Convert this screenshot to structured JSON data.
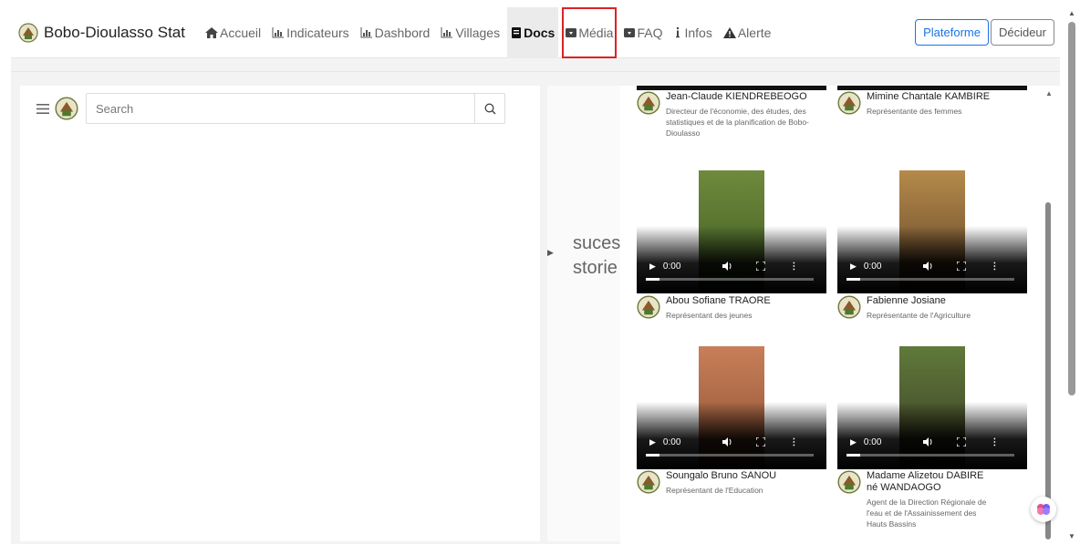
{
  "navbar": {
    "brand": "Bobo-Dioulasso Stat",
    "items": [
      {
        "label": "Accueil",
        "icon": "home-icon"
      },
      {
        "label": "Indicateurs",
        "icon": "bar-chart-icon"
      },
      {
        "label": "Dashbord",
        "icon": "bar-chart-icon"
      },
      {
        "label": "Villages",
        "icon": "bar-chart-icon"
      },
      {
        "label": "Docs",
        "icon": "book-icon"
      },
      {
        "label": "Média",
        "icon": "video-icon"
      },
      {
        "label": "FAQ",
        "icon": "video-icon"
      },
      {
        "label": "Infos",
        "icon": "info-icon"
      },
      {
        "label": "Alerte",
        "icon": "warning-icon"
      }
    ],
    "btn_platform": "Plateforme",
    "btn_decider": "Décideur"
  },
  "sidebar": {
    "search_placeholder": "Search"
  },
  "story": {
    "line1": "suces",
    "line2": "storie"
  },
  "media": {
    "people": [
      {
        "name": "Jean-Claude KIENDREBEOGO",
        "role": "Directeur de l'économie, des études, des statistiques et de la planification de Bobo-Dioulasso"
      },
      {
        "name": "Mimine Chantale KAMBIRE",
        "role": "Représentante des femmes"
      },
      {
        "name": "Abou Sofiane TRAORE",
        "role": "Représentant des jeunes"
      },
      {
        "name": "Fabienne Josiane",
        "role": "Représentante de l'Agriculture"
      },
      {
        "name": "Soungalo Bruno SANOU",
        "role": "Représentant de l'Education"
      },
      {
        "name": "Madame Alizetou DABIRE né WANDAOGO",
        "role": "Agent de la Direction Régionale de l'eau et de l'Assainissement des Hauts Bassins"
      }
    ],
    "video_time": "0:00",
    "colors": {
      "thumb_green": "#4f6b2e",
      "thumb_earth": "#9b5a3c",
      "thumb_brown": "#6b4a2e"
    }
  }
}
